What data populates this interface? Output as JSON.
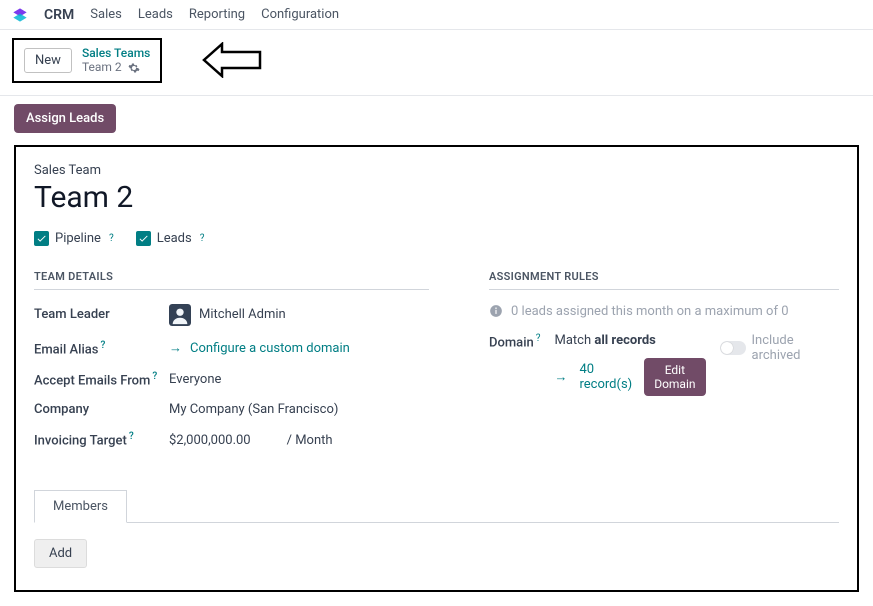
{
  "nav": {
    "brand": "CRM",
    "items": [
      "Sales",
      "Leads",
      "Reporting",
      "Configuration"
    ]
  },
  "crumb": {
    "new_label": "New",
    "parent": "Sales Teams",
    "current": "Team 2"
  },
  "buttons": {
    "assign_leads": "Assign Leads",
    "edit_domain": "Edit Domain",
    "add": "Add"
  },
  "form": {
    "head_label": "Sales Team",
    "title": "Team 2",
    "pipeline_label": "Pipeline",
    "leads_label": "Leads"
  },
  "details": {
    "heading": "TEAM DETAILS",
    "team_leader_label": "Team Leader",
    "team_leader_value": "Mitchell Admin",
    "email_alias_label": "Email Alias",
    "config_domain": "Configure a custom domain",
    "accept_label": "Accept Emails From",
    "accept_value": "Everyone",
    "company_label": "Company",
    "company_value": "My Company (San Francisco)",
    "target_label": "Invoicing Target",
    "target_value": "$2,000,000.00",
    "target_period": "/ Month"
  },
  "rules": {
    "heading": "ASSIGNMENT RULES",
    "info": "0 leads assigned this month on a maximum of 0",
    "domain_label": "Domain",
    "match_prefix": "Match ",
    "match_bold": "all records",
    "records": "40 record(s)",
    "include_archived": "Include archived"
  },
  "tabs": {
    "members": "Members"
  }
}
